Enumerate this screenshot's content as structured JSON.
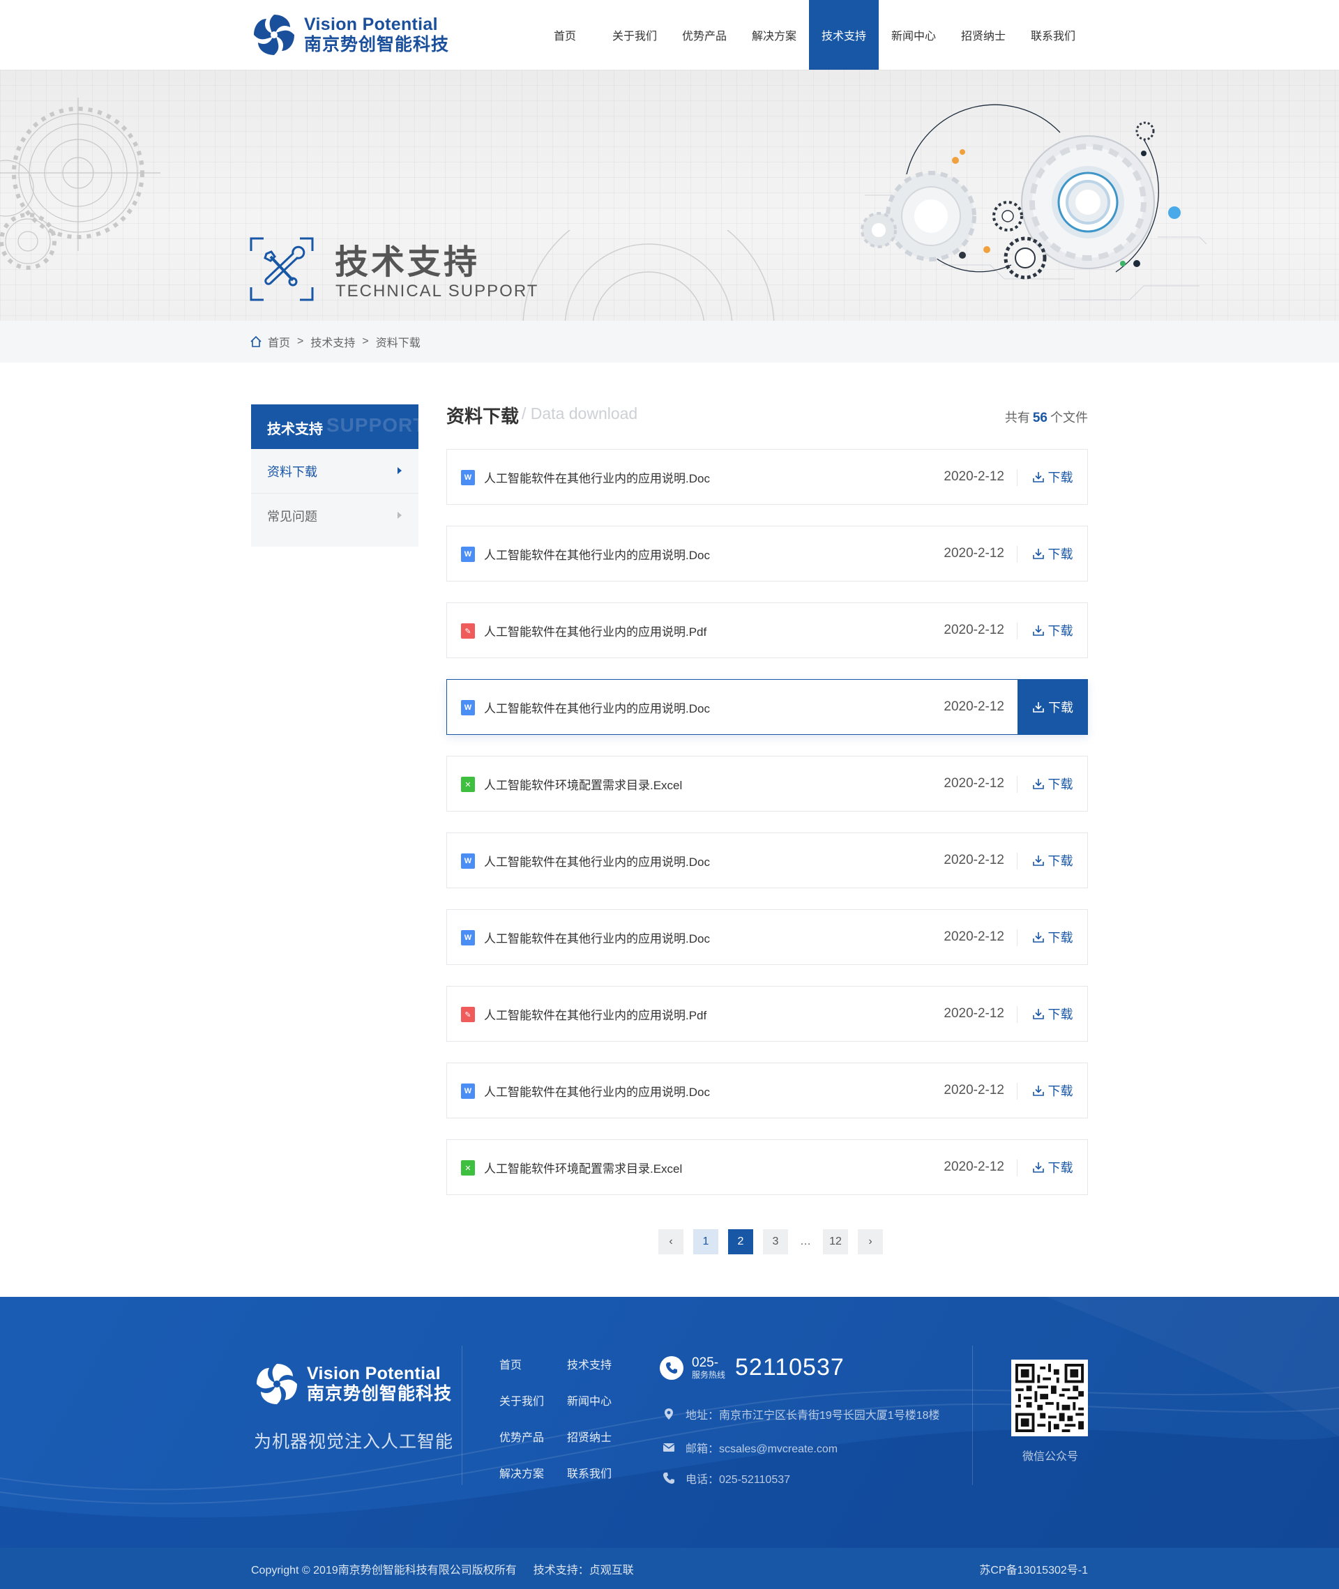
{
  "brand": {
    "name_en": "Vision Potential",
    "name_cn": "南京势创智能科技",
    "primary_color": "#1856a6"
  },
  "nav": {
    "items": [
      "首页",
      "关于我们",
      "优势产品",
      "解决方案",
      "技术支持",
      "新闻中心",
      "招贤纳士",
      "联系我们"
    ],
    "active": "技术支持"
  },
  "banner": {
    "title": "技术支持",
    "subtitle": "TECHNICAL SUPPORT",
    "icon": "tools-icon"
  },
  "breadcrumb": {
    "items": [
      "首页",
      "技术支持",
      "资料下载"
    ],
    "separator": ">"
  },
  "sidebar": {
    "title": "技术支持",
    "title_watermark": "SUPPORT",
    "items": [
      {
        "label": "资料下载",
        "active": true
      },
      {
        "label": "常见问题",
        "active": false
      }
    ]
  },
  "content": {
    "title": "资料下载",
    "title_en": "/ Data download",
    "count_prefix": "共有",
    "count": "56",
    "count_suffix": "个文件",
    "download_label": "下载",
    "files": [
      {
        "name": "人工智能软件在其他行业内的应用说明.Doc",
        "type": "doc",
        "date": "2020-2-12"
      },
      {
        "name": "人工智能软件在其他行业内的应用说明.Doc",
        "type": "doc",
        "date": "2020-2-12"
      },
      {
        "name": "人工智能软件在其他行业内的应用说明.Pdf",
        "type": "pdf",
        "date": "2020-2-12"
      },
      {
        "name": "人工智能软件在其他行业内的应用说明.Doc",
        "type": "doc",
        "date": "2020-2-12",
        "hover": true
      },
      {
        "name": "人工智能软件环境配置需求目录.Excel",
        "type": "xls",
        "date": "2020-2-12"
      },
      {
        "name": "人工智能软件在其他行业内的应用说明.Doc",
        "type": "doc",
        "date": "2020-2-12"
      },
      {
        "name": "人工智能软件在其他行业内的应用说明.Doc",
        "type": "doc",
        "date": "2020-2-12"
      },
      {
        "name": "人工智能软件在其他行业内的应用说明.Pdf",
        "type": "pdf",
        "date": "2020-2-12"
      },
      {
        "name": "人工智能软件在其他行业内的应用说明.Doc",
        "type": "doc",
        "date": "2020-2-12"
      },
      {
        "name": "人工智能软件环境配置需求目录.Excel",
        "type": "xls",
        "date": "2020-2-12"
      }
    ]
  },
  "pagination": {
    "prev": "‹",
    "next": "›",
    "pages": [
      "1",
      "2",
      "3",
      "…",
      "12"
    ],
    "current": "2",
    "visited": "1"
  },
  "footer": {
    "slogan": "为机器视觉注入人工智能",
    "links": [
      "首页",
      "技术支持",
      "关于我们",
      "新闻中心",
      "优势产品",
      "招贤纳士",
      "解决方案",
      "联系我们"
    ],
    "hotline_area": "025-",
    "hotline_label": "服务热线",
    "hotline_number": "52110537",
    "address": "地址：南京市江宁区长青街19号长园大厦1号楼18楼",
    "email": "邮箱：scsales@mvcreate.com",
    "phone": "电话：025-52110537",
    "qr_label": "微信公众号",
    "copyright": "Copyright © 2019南京势创智能科技有限公司版权所有",
    "tech_support": "技术支持：贞观互联",
    "icp": "苏CP备13015302号-1"
  }
}
